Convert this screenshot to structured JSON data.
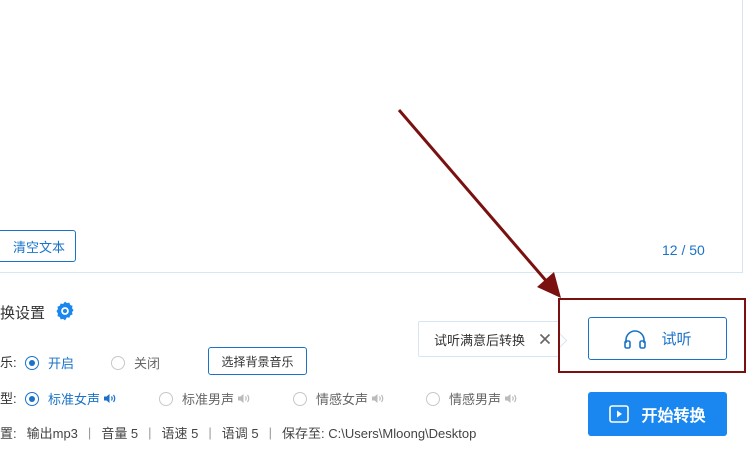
{
  "editor": {
    "clear_label": "清空文本",
    "counter": "12 / 50"
  },
  "settings": {
    "title": "换设置",
    "bgm": {
      "label": "乐:",
      "option_on": "开启",
      "option_off": "关闭",
      "select_button": "选择背景音乐"
    },
    "voice": {
      "label": "型:",
      "options": [
        "标准女声",
        "标准男声",
        "情感女声",
        "情感男声"
      ],
      "selected": "标准女声"
    },
    "info": {
      "label": "置:",
      "format": "输出mp3",
      "volume": "音量 5",
      "speed": "语速 5",
      "pitch": "语调 5",
      "save_path": "保存至: C:\\Users\\Mloong\\Desktop"
    }
  },
  "tooltip": {
    "text": "试听满意后转换"
  },
  "actions": {
    "listen_label": "试听",
    "start_label": "开始转换"
  },
  "colors": {
    "accent": "#1a73c8",
    "primary_button": "#1a86f0",
    "annotation": "#7a1010"
  },
  "icons": {
    "gear": "gear-icon",
    "speaker": "speaker-icon",
    "headphones": "headphones-icon",
    "play": "play-icon",
    "close": "close-icon"
  }
}
